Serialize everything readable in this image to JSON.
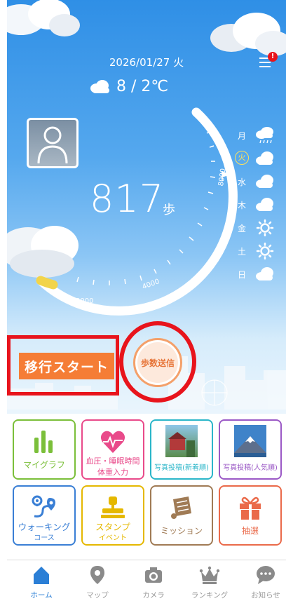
{
  "header": {
    "date": "2026/01/27 火",
    "weather": "8 / 2℃",
    "menu_icon": "menu-icon",
    "badge_glyph": "!"
  },
  "steps": {
    "count": "817",
    "unit": "歩",
    "goal_marker": "8000",
    "arc_labels": [
      "2000",
      "4000",
      "8000"
    ],
    "progress_fraction": 0.1
  },
  "week": [
    {
      "label": "月",
      "weather": "rain-icon",
      "today": false
    },
    {
      "label": "火",
      "weather": "cloud-icon",
      "today": true
    },
    {
      "label": "水",
      "weather": "cloud-icon",
      "today": false
    },
    {
      "label": "木",
      "weather": "cloud-icon",
      "today": false
    },
    {
      "label": "金",
      "weather": "sun-icon",
      "today": false
    },
    {
      "label": "土",
      "weather": "sun-icon",
      "today": false
    },
    {
      "label": "日",
      "weather": "cloud-icon",
      "today": false
    }
  ],
  "actions": {
    "migrate_label": "移行スタート",
    "send_label": "歩数送信"
  },
  "tiles": [
    {
      "label": "マイグラフ",
      "color": "#7bbf3a",
      "icon": "bar-chart-icon"
    },
    {
      "label1": "血圧・睡眠時間",
      "label2": "体重入力",
      "color": "#e94a8a",
      "icon": "heart-icon"
    },
    {
      "label": "写真投稿(新着順)",
      "color": "#2bb6c9",
      "icon": "photo-new-icon"
    },
    {
      "label": "写真投稿(人気順)",
      "color": "#9b59c6",
      "icon": "photo-popular-icon"
    },
    {
      "label1": "ウォーキング",
      "label2": "コース",
      "color": "#3a7fd5",
      "icon": "route-icon"
    },
    {
      "label1": "スタンプ",
      "label2": "イベント",
      "color": "#e5b800",
      "icon": "stamp-icon"
    },
    {
      "label": "ミッション",
      "color": "#a07b55",
      "icon": "scroll-icon"
    },
    {
      "label": "抽選",
      "color": "#ea6a4a",
      "icon": "gift-icon"
    }
  ],
  "tabbar": [
    {
      "label": "ホーム",
      "icon": "home-icon",
      "active": true
    },
    {
      "label": "マップ",
      "icon": "map-pin-icon",
      "active": false
    },
    {
      "label": "カメラ",
      "icon": "camera-icon",
      "active": false
    },
    {
      "label": "ランキング",
      "icon": "crown-icon",
      "active": false
    },
    {
      "label": "お知らせ",
      "icon": "chat-bubble-icon",
      "active": false
    }
  ],
  "colors": {
    "accent_blue": "#2b7fd6",
    "highlight_red": "#e8141c",
    "migrate_orange": "#f57d36",
    "progress_yellow": "#f2d44a"
  }
}
